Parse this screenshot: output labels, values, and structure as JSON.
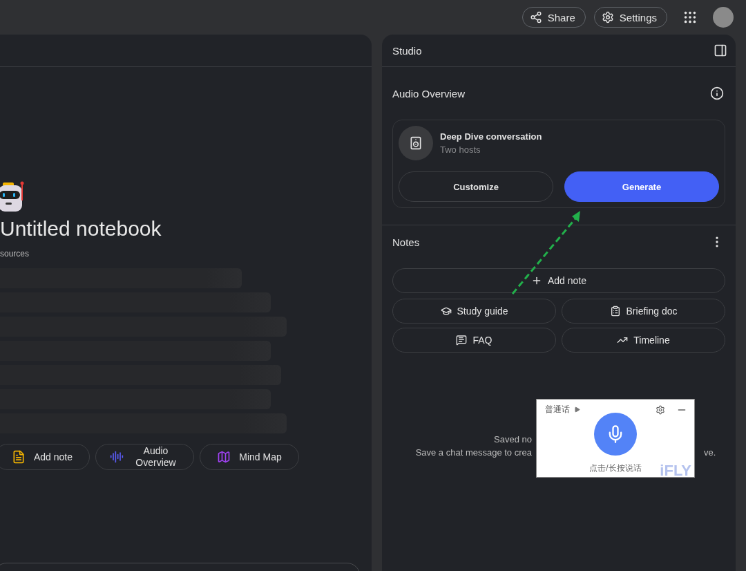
{
  "top_bar": {
    "buttons": [
      {
        "kind": "share",
        "label": "Share"
      },
      {
        "kind": "settings",
        "label": "Settings"
      }
    ]
  },
  "notebook": {
    "title": "Untitled notebook",
    "subtitle": "sources",
    "actions": [
      {
        "kind": "note",
        "label": "Add note"
      },
      {
        "kind": "audio",
        "label": "Audio Overview"
      },
      {
        "kind": "map",
        "label": "Mind Map"
      }
    ]
  },
  "studio": {
    "title": "Studio",
    "audio_overview": {
      "title": "Audio Overview",
      "card_title": "Deep Dive conversation",
      "card_subtitle": "Two hosts",
      "buttons": [
        {
          "label": "Customize",
          "primary": false
        },
        {
          "label": "Generate",
          "primary": true
        }
      ]
    },
    "notes": {
      "title": "Notes",
      "add_note": "Add note",
      "actions": [
        {
          "kind": "study",
          "label": "Study guide"
        },
        {
          "kind": "briefing",
          "label": "Briefing doc"
        },
        {
          "kind": "faq",
          "label": "FAQ"
        },
        {
          "kind": "timeline",
          "label": "Timeline"
        }
      ],
      "empty_title": "Saved no",
      "empty_text": "Save a chat message to crea",
      "empty_text_end": "ve."
    }
  },
  "voice_popup": {
    "language": "普通话",
    "hint": "点击/长按说话",
    "logo_text": "iFLY"
  }
}
